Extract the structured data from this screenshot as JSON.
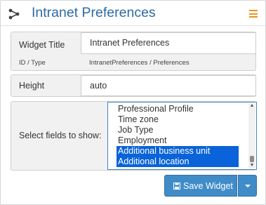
{
  "header": {
    "title": "Intranet Preferences",
    "icon": "share-nodes-icon",
    "menu_icon": "hamburger-menu-icon"
  },
  "widget_title": {
    "label": "Widget Title",
    "value": "Intranet Preferences",
    "id_type_label": "ID / Type",
    "id_type_value": "IntranetPreferences / Preferences"
  },
  "height": {
    "label": "Height",
    "value": "auto"
  },
  "fields": {
    "label": "Select fields to show:",
    "options": [
      {
        "label": "Professional Profile",
        "selected": false
      },
      {
        "label": "Time zone",
        "selected": false
      },
      {
        "label": "Job Type",
        "selected": false
      },
      {
        "label": "Employment",
        "selected": false
      },
      {
        "label": "Additional business unit",
        "selected": true
      },
      {
        "label": "Additional location",
        "selected": true
      }
    ]
  },
  "actions": {
    "save_label": "Save Widget",
    "save_icon": "floppy-disk-icon",
    "dropdown_icon": "caret-down-icon"
  },
  "colors": {
    "title": "#2c6aa6",
    "menu": "#e8931f",
    "button": "#3f8cc9",
    "selection": "#0a63d8"
  }
}
